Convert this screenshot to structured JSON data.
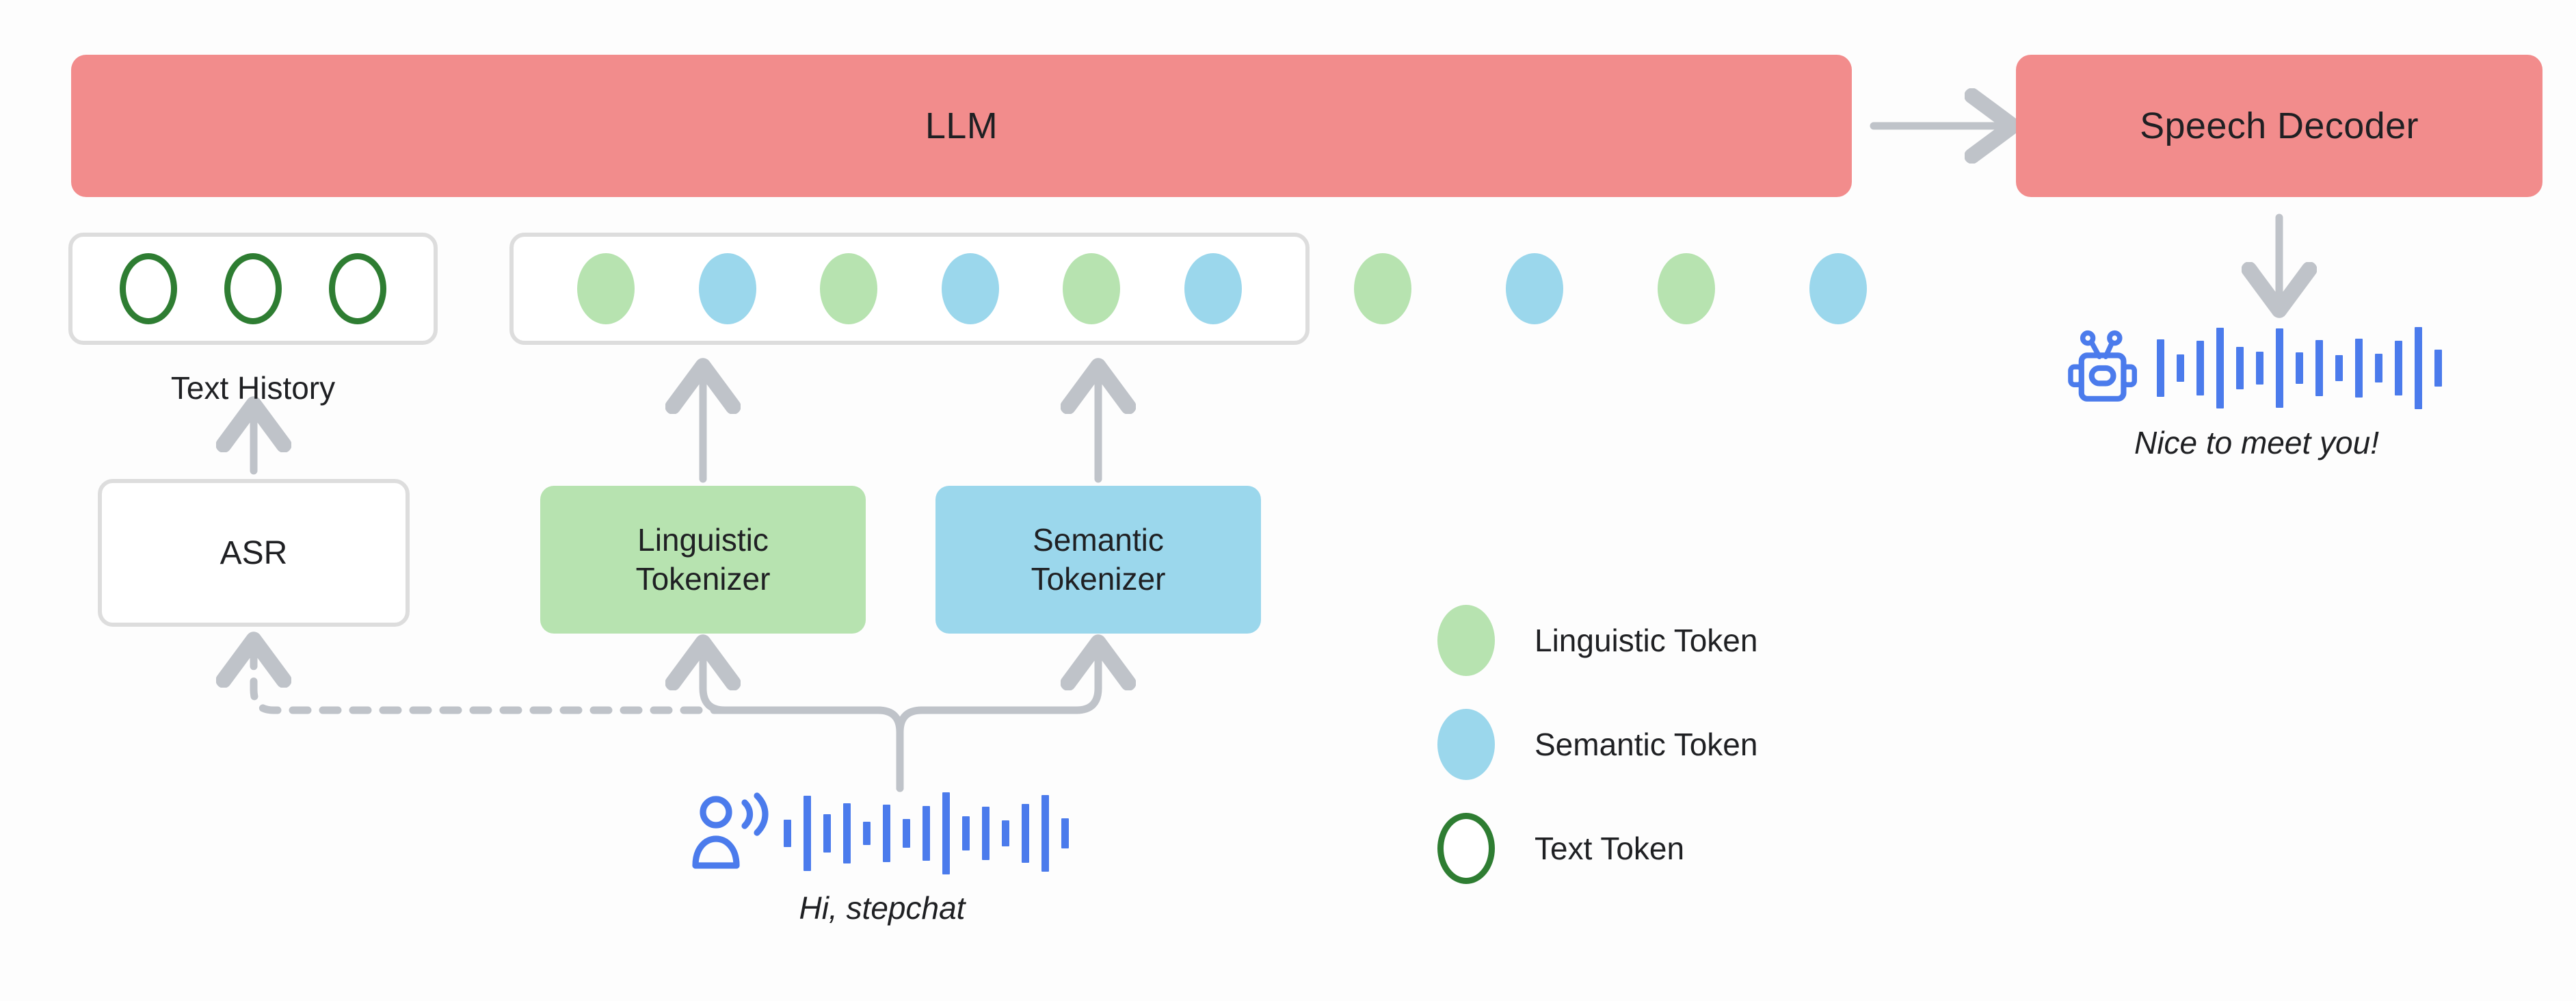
{
  "diagram": {
    "title": "Speech LLM architecture with dual tokenizers",
    "colors": {
      "model_block": "#F28C8C",
      "linguistic_token": "#B7E3B0",
      "semantic_token": "#9BD7EC",
      "text_token_stroke": "#2E7D32",
      "wire": "#BFC3C9",
      "waveform": "#4B7BEC",
      "box_border": "#DDDDDD",
      "background": "#FDFDFD"
    }
  },
  "blocks": {
    "llm": "LLM",
    "speech_decoder": "Speech Decoder",
    "asr": "ASR",
    "linguistic_tokenizer_line1": "Linguistic",
    "linguistic_tokenizer_line2": "Tokenizer",
    "semantic_tokenizer_line1": "Semantic",
    "semantic_tokenizer_line2": "Tokenizer"
  },
  "text_history": {
    "caption": "Text History",
    "tokens": [
      "text",
      "text",
      "text"
    ]
  },
  "token_sequence": {
    "boxed": [
      "ling",
      "sem",
      "ling",
      "sem",
      "ling",
      "sem"
    ],
    "free": [
      "ling",
      "sem",
      "ling",
      "sem"
    ]
  },
  "legend": {
    "items": [
      {
        "type": "ling",
        "label": "Linguistic Token"
      },
      {
        "type": "sem",
        "label": "Semantic Token"
      },
      {
        "type": "text",
        "label": "Text Token"
      }
    ]
  },
  "user_speech": {
    "icon": "person-speaking-icon",
    "transcript": "Hi, stepchat",
    "waveform": [
      40,
      110,
      56,
      88,
      34,
      84,
      42,
      80,
      120,
      50,
      78,
      38,
      86,
      112,
      44
    ]
  },
  "bot_speech": {
    "icon": "robot-icon",
    "transcript": "Nice to meet you!",
    "waveform": [
      84,
      40,
      80,
      118,
      62,
      48,
      116,
      46,
      82,
      38,
      86,
      42,
      80,
      120,
      54
    ]
  },
  "edges": {
    "llm_to_decoder": "arrow-right",
    "decoder_to_speech": "arrow-down",
    "asr_to_text_history": "arrow-up",
    "ling_tok_to_tokens": "arrow-up",
    "sem_tok_to_tokens": "arrow-up",
    "speech_to_tokenizers": "branch-up",
    "speech_to_asr": "dashed-arrow-left-up"
  }
}
